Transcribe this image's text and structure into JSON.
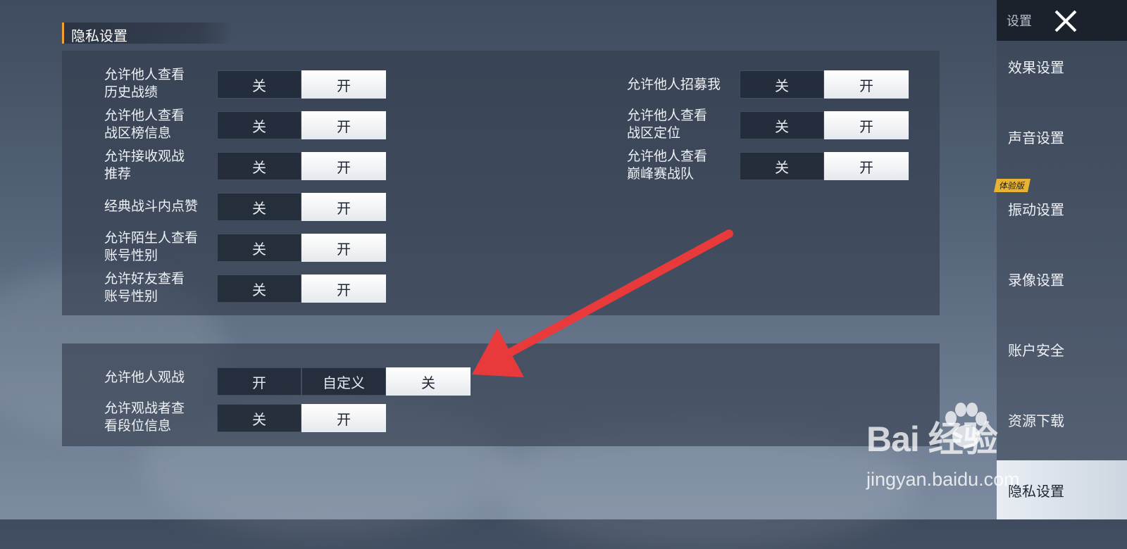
{
  "section_title": "隐私设置",
  "left_settings": [
    {
      "label": "允许他人查看\n历史战绩",
      "options": [
        "关",
        "开"
      ],
      "selected": "开"
    },
    {
      "label": "允许他人查看\n战区榜信息",
      "options": [
        "关",
        "开"
      ],
      "selected": "开"
    },
    {
      "label": "允许接收观战\n推荐",
      "options": [
        "关",
        "开"
      ],
      "selected": "开"
    },
    {
      "label": "经典战斗内点赞",
      "options": [
        "关",
        "开"
      ],
      "selected": "开"
    },
    {
      "label": "允许陌生人查看\n账号性别",
      "options": [
        "关",
        "开"
      ],
      "selected": "开"
    },
    {
      "label": "允许好友查看\n账号性别",
      "options": [
        "关",
        "开"
      ],
      "selected": "开"
    }
  ],
  "right_settings": [
    {
      "label": "允许他人招募我",
      "options": [
        "关",
        "开"
      ],
      "selected": "开"
    },
    {
      "label": "允许他人查看\n战区定位",
      "options": [
        "关",
        "开"
      ],
      "selected": "开"
    },
    {
      "label": "允许他人查看\n巅峰赛战队",
      "options": [
        "关",
        "开"
      ],
      "selected": "开"
    }
  ],
  "spectate_settings": [
    {
      "label": "允许他人观战",
      "options": [
        "开",
        "自定义",
        "关"
      ],
      "selected": "关"
    },
    {
      "label": "允许观战者查\n看段位信息",
      "options": [
        "关",
        "开"
      ],
      "selected": "开"
    }
  ],
  "sidebar": {
    "title": "设置",
    "items": [
      {
        "label": "效果设置",
        "active": false
      },
      {
        "label": "声音设置",
        "active": false
      },
      {
        "label": "振动设置",
        "active": false,
        "badge": "体验版"
      },
      {
        "label": "录像设置",
        "active": false
      },
      {
        "label": "账户安全",
        "active": false
      },
      {
        "label": "资源下载",
        "active": false
      },
      {
        "label": "隐私设置",
        "active": true
      }
    ]
  },
  "watermark": {
    "brand": "Bai  经验",
    "url": "jingyan.baidu.com"
  },
  "colors": {
    "accent": "#f0a030",
    "arrow": "#e8393b",
    "badge": "#e8b330"
  }
}
